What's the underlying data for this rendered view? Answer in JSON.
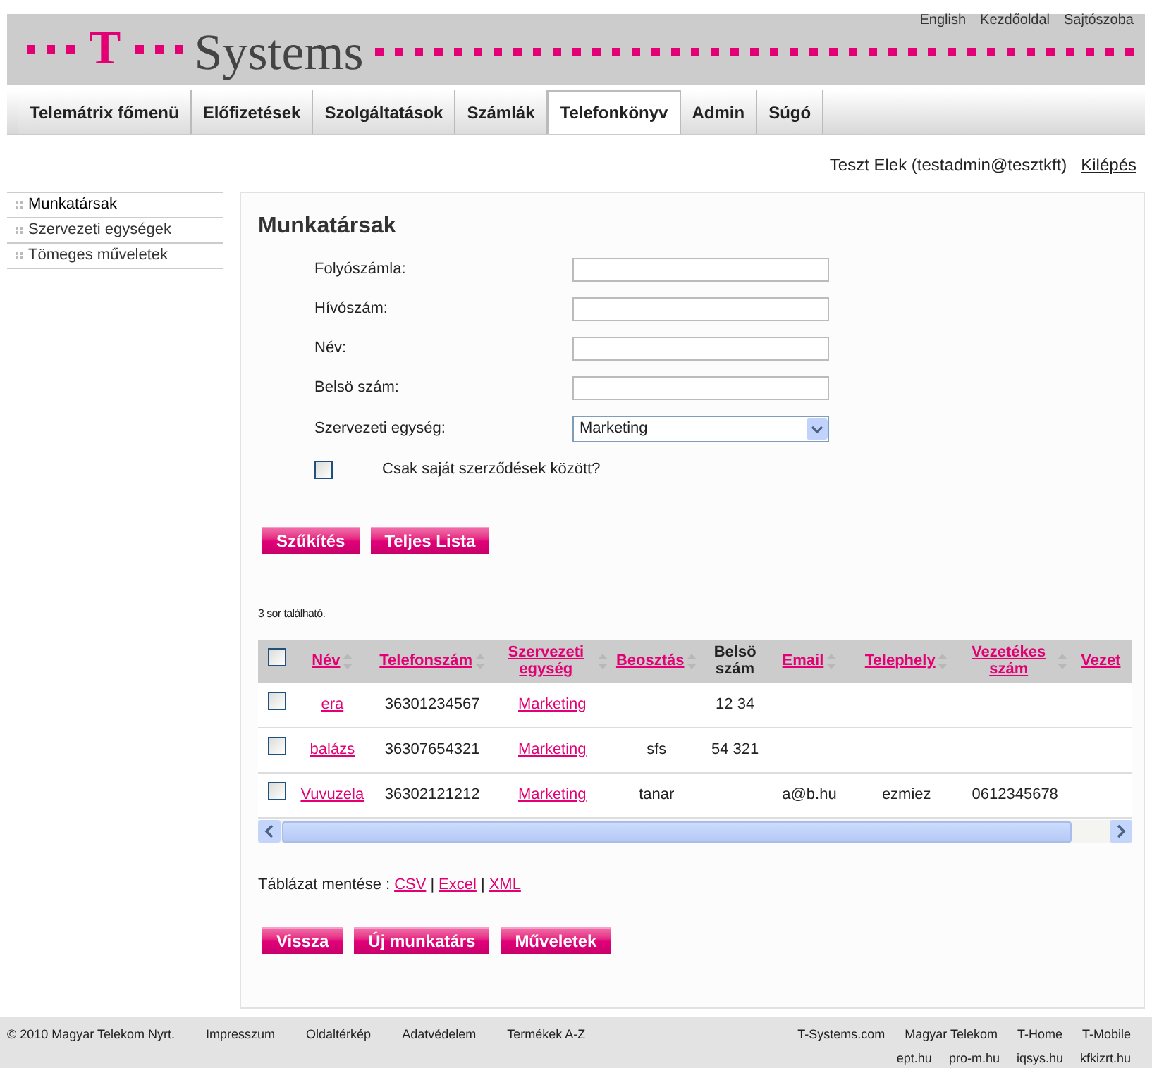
{
  "top_links": [
    "English",
    "Kezdőoldal",
    "Sajtószoba"
  ],
  "logo": {
    "mark": "T",
    "wordmark": "Systems"
  },
  "nav": [
    {
      "label": "Telemátrix főmenü",
      "selected": false
    },
    {
      "label": "Előfizetések",
      "selected": false
    },
    {
      "label": "Szolgáltatások",
      "selected": false
    },
    {
      "label": "Számlák",
      "selected": false
    },
    {
      "label": "Telefonkönyv",
      "selected": true
    },
    {
      "label": "Admin",
      "selected": false
    },
    {
      "label": "Súgó",
      "selected": false
    }
  ],
  "user": {
    "name": "Teszt Elek (testadmin@tesztkft)",
    "logout": "Kilépés"
  },
  "sidebar": {
    "items": [
      {
        "label": "Munkatársak",
        "selected": true
      },
      {
        "label": "Szervezeti egységek",
        "selected": false
      },
      {
        "label": "Tömeges műveletek",
        "selected": false
      }
    ]
  },
  "page_title": "Munkatársak",
  "form": {
    "fields": [
      {
        "label": "Folyószámla:",
        "kind": "text"
      },
      {
        "label": "Hívószám:",
        "kind": "text"
      },
      {
        "label": "Név:",
        "kind": "text"
      },
      {
        "label": "Belsö szám:",
        "kind": "text"
      },
      {
        "label": "Szervezeti egység:",
        "kind": "select",
        "value": "Marketing"
      }
    ],
    "checkbox": {
      "label": "Csak saját szerződések között?",
      "checked": false
    },
    "buttons": [
      "Szűkítés",
      "Teljes Lista"
    ]
  },
  "result_count": "3 sor található.",
  "table": {
    "header_checkbox": {
      "checked": false
    },
    "columns": [
      {
        "label": "Név",
        "sortable": true
      },
      {
        "label": "Telefonszám",
        "sortable": true
      },
      {
        "label": "Szervezeti egység",
        "sortable": true
      },
      {
        "label": "Beosztás",
        "sortable": true
      },
      {
        "label": "Belsö szám",
        "sortable": false
      },
      {
        "label": "Email",
        "sortable": true
      },
      {
        "label": "Telephely",
        "sortable": true
      },
      {
        "label": "Vezetékes szám",
        "sortable": true
      },
      {
        "label": "Vezet",
        "sortable": false
      }
    ],
    "rows": [
      {
        "checked": false,
        "cells": [
          "era",
          "36301234567",
          "Marketing",
          "",
          "12 34",
          "",
          "",
          "",
          ""
        ]
      },
      {
        "checked": false,
        "cells": [
          "balázs",
          "36307654321",
          "Marketing",
          "sfs",
          "54 321",
          "",
          "",
          "",
          ""
        ]
      },
      {
        "checked": false,
        "cells": [
          "Vuvuzela",
          "36302121212",
          "Marketing",
          "tanar",
          "",
          "a@b.hu",
          "ezmiez",
          "0612345678",
          ""
        ]
      }
    ]
  },
  "export": {
    "label": "Táblázat mentése :",
    "separator": "|",
    "links": [
      "CSV",
      "Excel",
      "XML"
    ]
  },
  "bottom_buttons": [
    "Vissza",
    "Új munkatárs",
    "Műveletek"
  ],
  "footer": {
    "copyright": "© 2010 Magyar Telekom Nyrt.",
    "links": [
      "Impresszum",
      "Oldaltérkép",
      "Adatvédelem",
      "Termékek A-Z"
    ],
    "right_links": [
      "T-Systems.com",
      "Magyar Telekom",
      "T-Home",
      "T-Mobile"
    ],
    "right_links_2": [
      "ept.hu",
      "pro-m.hu",
      "iqsys.hu",
      "kfkizrt.hu"
    ]
  }
}
